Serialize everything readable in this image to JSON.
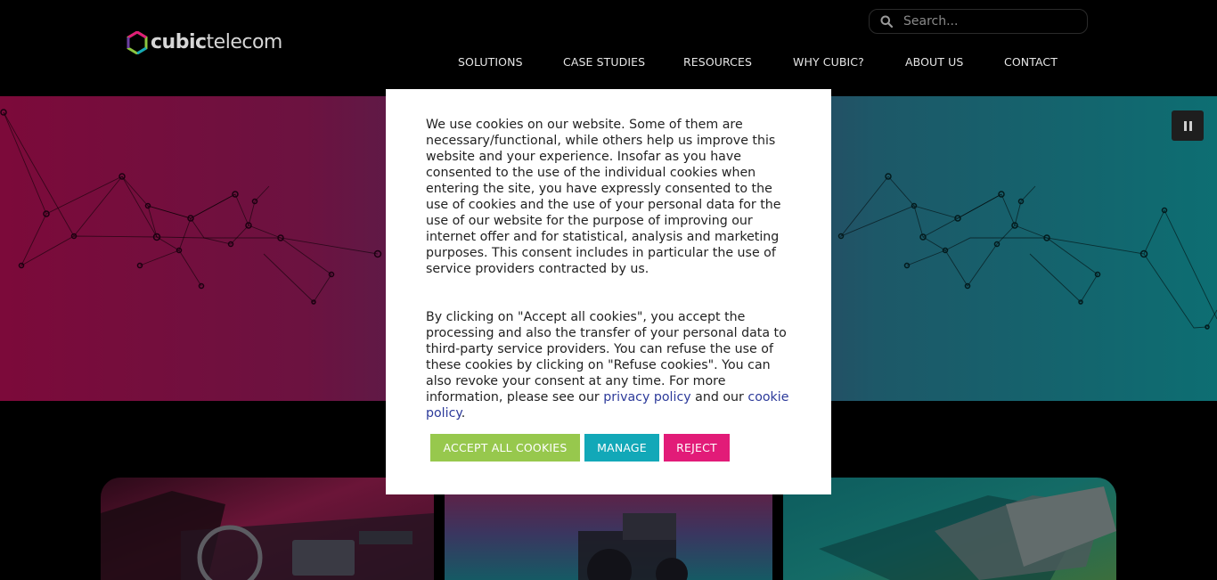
{
  "header": {
    "logo": {
      "bold": "cubic",
      "light": "telecom"
    },
    "search": {
      "placeholder": "Search..."
    },
    "nav": [
      {
        "label": "SOLUTIONS"
      },
      {
        "label": "CASE STUDIES"
      },
      {
        "label": "RESOURCES"
      },
      {
        "label": "WHY CUBIC?"
      },
      {
        "label": "ABOUT US"
      },
      {
        "label": "CONTACT"
      }
    ]
  },
  "hero": {
    "gradient_colors": [
      "#7c0a3a",
      "#3f2d56",
      "#0d6e72"
    ],
    "pause_icon": "pause-icon"
  },
  "cookie_modal": {
    "paragraph1": "We use cookies on our website. Some of them are necessary/functional, while others help us improve this website and your experience. Insofar as you have consented to the use of the individual cookies when entering the site, you have expressly consented to the use of cookies and the use of your personal data for the use of our website for the purpose of improving our internet offer and for statistical, analysis and marketing purposes. This consent includes in particular the use of service providers contracted by us.",
    "paragraph2_text": "By clicking on \"Accept all cookies\", you accept the processing and also the transfer of your personal data to third-party service providers. You can refuse the use of these cookies by clicking on \"Refuse cookies\". You can also revoke your consent at any time. For more information, please see our",
    "privacy_link": "privacy policy",
    "and_our": "and our",
    "cookie_link": "cookie policy",
    "end_period": ".",
    "buttons": {
      "accept": "ACCEPT ALL COOKIES",
      "manage": "MANAGE",
      "reject": "REJECT"
    },
    "colors": {
      "accept": "#97c84d",
      "manage": "#12a8b8",
      "reject": "#e21b78",
      "link": "#2c3a9a"
    }
  }
}
